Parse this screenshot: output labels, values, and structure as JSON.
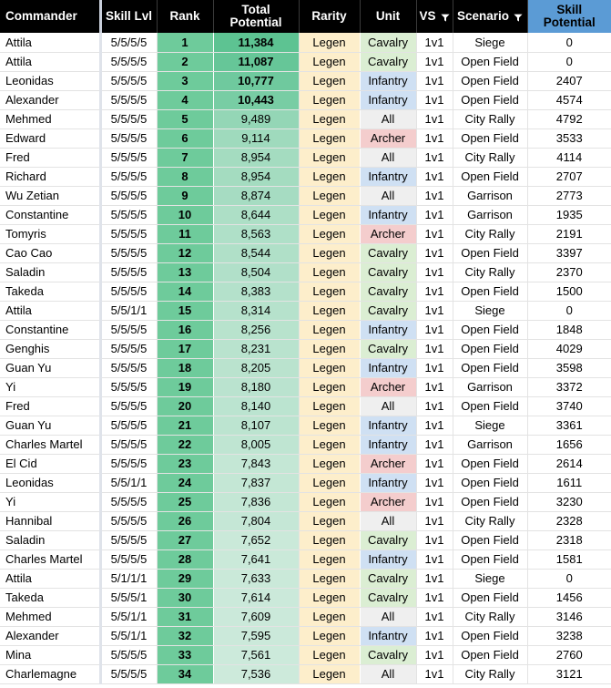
{
  "table": {
    "columns": [
      {
        "key": "commander",
        "label": "Commander",
        "filter": false
      },
      {
        "key": "skill_lvl",
        "label": "Skill Lvl",
        "filter": false
      },
      {
        "key": "rank",
        "label": "Rank",
        "filter": false
      },
      {
        "key": "total_potential",
        "label": "Total Potential",
        "filter": false
      },
      {
        "key": "rarity",
        "label": "Rarity",
        "filter": false
      },
      {
        "key": "unit",
        "label": "Unit",
        "filter": false
      },
      {
        "key": "vs",
        "label": "VS",
        "filter": true,
        "filter_icon": "filter-icon"
      },
      {
        "key": "scenario",
        "label": "Scenario",
        "filter": true,
        "filter_icon": "filter-icon"
      },
      {
        "key": "skill_potential",
        "label": "Skill Potential",
        "filter": false
      }
    ],
    "header_colors": {
      "background": "#000000",
      "text": "#ffffff",
      "skill_potential_background": "#5b9bd5",
      "skill_potential_text": "#000000"
    },
    "cell_colors": {
      "rank": "#6ecb9b",
      "total_high": "#5dc392",
      "total_low": "#cdeadb",
      "rarity_legendary": "#fdeecb",
      "unit_cavalry": "#dbeed3",
      "unit_infantry": "#cfe0f3",
      "unit_archer": "#f4cdcd",
      "unit_all": "#efefef",
      "row_background": "#ffffff"
    },
    "rows": [
      {
        "commander": "Attila",
        "skill_lvl": "5/5/5/5",
        "rank": "1",
        "total_potential": "11,384",
        "rarity": "Legen",
        "unit": "Cavalry",
        "vs": "1v1",
        "scenario": "Siege",
        "skill_potential": "0"
      },
      {
        "commander": "Attila",
        "skill_lvl": "5/5/5/5",
        "rank": "2",
        "total_potential": "11,087",
        "rarity": "Legen",
        "unit": "Cavalry",
        "vs": "1v1",
        "scenario": "Open Field",
        "skill_potential": "0"
      },
      {
        "commander": "Leonidas",
        "skill_lvl": "5/5/5/5",
        "rank": "3",
        "total_potential": "10,777",
        "rarity": "Legen",
        "unit": "Infantry",
        "vs": "1v1",
        "scenario": "Open Field",
        "skill_potential": "2407"
      },
      {
        "commander": "Alexander",
        "skill_lvl": "5/5/5/5",
        "rank": "4",
        "total_potential": "10,443",
        "rarity": "Legen",
        "unit": "Infantry",
        "vs": "1v1",
        "scenario": "Open Field",
        "skill_potential": "4574"
      },
      {
        "commander": "Mehmed",
        "skill_lvl": "5/5/5/5",
        "rank": "5",
        "total_potential": "9,489",
        "rarity": "Legen",
        "unit": "All",
        "vs": "1v1",
        "scenario": "City Rally",
        "skill_potential": "4792"
      },
      {
        "commander": "Edward",
        "skill_lvl": "5/5/5/5",
        "rank": "6",
        "total_potential": "9,114",
        "rarity": "Legen",
        "unit": "Archer",
        "vs": "1v1",
        "scenario": "Open Field",
        "skill_potential": "3533"
      },
      {
        "commander": "Fred",
        "skill_lvl": "5/5/5/5",
        "rank": "7",
        "total_potential": "8,954",
        "rarity": "Legen",
        "unit": "All",
        "vs": "1v1",
        "scenario": "City Rally",
        "skill_potential": "4114"
      },
      {
        "commander": "Richard",
        "skill_lvl": "5/5/5/5",
        "rank": "8",
        "total_potential": "8,954",
        "rarity": "Legen",
        "unit": "Infantry",
        "vs": "1v1",
        "scenario": "Open Field",
        "skill_potential": "2707"
      },
      {
        "commander": "Wu Zetian",
        "skill_lvl": "5/5/5/5",
        "rank": "9",
        "total_potential": "8,874",
        "rarity": "Legen",
        "unit": "All",
        "vs": "1v1",
        "scenario": "Garrison",
        "skill_potential": "2773"
      },
      {
        "commander": "Constantine",
        "skill_lvl": "5/5/5/5",
        "rank": "10",
        "total_potential": "8,644",
        "rarity": "Legen",
        "unit": "Infantry",
        "vs": "1v1",
        "scenario": "Garrison",
        "skill_potential": "1935"
      },
      {
        "commander": "Tomyris",
        "skill_lvl": "5/5/5/5",
        "rank": "11",
        "total_potential": "8,563",
        "rarity": "Legen",
        "unit": "Archer",
        "vs": "1v1",
        "scenario": "City Rally",
        "skill_potential": "2191"
      },
      {
        "commander": "Cao Cao",
        "skill_lvl": "5/5/5/5",
        "rank": "12",
        "total_potential": "8,544",
        "rarity": "Legen",
        "unit": "Cavalry",
        "vs": "1v1",
        "scenario": "Open Field",
        "skill_potential": "3397"
      },
      {
        "commander": "Saladin",
        "skill_lvl": "5/5/5/5",
        "rank": "13",
        "total_potential": "8,504",
        "rarity": "Legen",
        "unit": "Cavalry",
        "vs": "1v1",
        "scenario": "City Rally",
        "skill_potential": "2370"
      },
      {
        "commander": "Takeda",
        "skill_lvl": "5/5/5/5",
        "rank": "14",
        "total_potential": "8,383",
        "rarity": "Legen",
        "unit": "Cavalry",
        "vs": "1v1",
        "scenario": "Open Field",
        "skill_potential": "1500"
      },
      {
        "commander": "Attila",
        "skill_lvl": "5/5/1/1",
        "rank": "15",
        "total_potential": "8,314",
        "rarity": "Legen",
        "unit": "Cavalry",
        "vs": "1v1",
        "scenario": "Siege",
        "skill_potential": "0"
      },
      {
        "commander": "Constantine",
        "skill_lvl": "5/5/5/5",
        "rank": "16",
        "total_potential": "8,256",
        "rarity": "Legen",
        "unit": "Infantry",
        "vs": "1v1",
        "scenario": "Open Field",
        "skill_potential": "1848"
      },
      {
        "commander": "Genghis",
        "skill_lvl": "5/5/5/5",
        "rank": "17",
        "total_potential": "8,231",
        "rarity": "Legen",
        "unit": "Cavalry",
        "vs": "1v1",
        "scenario": "Open Field",
        "skill_potential": "4029"
      },
      {
        "commander": "Guan Yu",
        "skill_lvl": "5/5/5/5",
        "rank": "18",
        "total_potential": "8,205",
        "rarity": "Legen",
        "unit": "Infantry",
        "vs": "1v1",
        "scenario": "Open Field",
        "skill_potential": "3598"
      },
      {
        "commander": "Yi",
        "skill_lvl": "5/5/5/5",
        "rank": "19",
        "total_potential": "8,180",
        "rarity": "Legen",
        "unit": "Archer",
        "vs": "1v1",
        "scenario": "Garrison",
        "skill_potential": "3372"
      },
      {
        "commander": "Fred",
        "skill_lvl": "5/5/5/5",
        "rank": "20",
        "total_potential": "8,140",
        "rarity": "Legen",
        "unit": "All",
        "vs": "1v1",
        "scenario": "Open Field",
        "skill_potential": "3740"
      },
      {
        "commander": "Guan Yu",
        "skill_lvl": "5/5/5/5",
        "rank": "21",
        "total_potential": "8,107",
        "rarity": "Legen",
        "unit": "Infantry",
        "vs": "1v1",
        "scenario": "Siege",
        "skill_potential": "3361"
      },
      {
        "commander": "Charles Martel",
        "skill_lvl": "5/5/5/5",
        "rank": "22",
        "total_potential": "8,005",
        "rarity": "Legen",
        "unit": "Infantry",
        "vs": "1v1",
        "scenario": "Garrison",
        "skill_potential": "1656"
      },
      {
        "commander": "El Cid",
        "skill_lvl": "5/5/5/5",
        "rank": "23",
        "total_potential": "7,843",
        "rarity": "Legen",
        "unit": "Archer",
        "vs": "1v1",
        "scenario": "Open Field",
        "skill_potential": "2614"
      },
      {
        "commander": "Leonidas",
        "skill_lvl": "5/5/1/1",
        "rank": "24",
        "total_potential": "7,837",
        "rarity": "Legen",
        "unit": "Infantry",
        "vs": "1v1",
        "scenario": "Open Field",
        "skill_potential": "1611"
      },
      {
        "commander": "Yi",
        "skill_lvl": "5/5/5/5",
        "rank": "25",
        "total_potential": "7,836",
        "rarity": "Legen",
        "unit": "Archer",
        "vs": "1v1",
        "scenario": "Open Field",
        "skill_potential": "3230"
      },
      {
        "commander": "Hannibal",
        "skill_lvl": "5/5/5/5",
        "rank": "26",
        "total_potential": "7,804",
        "rarity": "Legen",
        "unit": "All",
        "vs": "1v1",
        "scenario": "City Rally",
        "skill_potential": "2328"
      },
      {
        "commander": "Saladin",
        "skill_lvl": "5/5/5/5",
        "rank": "27",
        "total_potential": "7,652",
        "rarity": "Legen",
        "unit": "Cavalry",
        "vs": "1v1",
        "scenario": "Open Field",
        "skill_potential": "2318"
      },
      {
        "commander": "Charles Martel",
        "skill_lvl": "5/5/5/5",
        "rank": "28",
        "total_potential": "7,641",
        "rarity": "Legen",
        "unit": "Infantry",
        "vs": "1v1",
        "scenario": "Open Field",
        "skill_potential": "1581"
      },
      {
        "commander": "Attila",
        "skill_lvl": "5/1/1/1",
        "rank": "29",
        "total_potential": "7,633",
        "rarity": "Legen",
        "unit": "Cavalry",
        "vs": "1v1",
        "scenario": "Siege",
        "skill_potential": "0"
      },
      {
        "commander": "Takeda",
        "skill_lvl": "5/5/5/1",
        "rank": "30",
        "total_potential": "7,614",
        "rarity": "Legen",
        "unit": "Cavalry",
        "vs": "1v1",
        "scenario": "Open Field",
        "skill_potential": "1456"
      },
      {
        "commander": "Mehmed",
        "skill_lvl": "5/5/1/1",
        "rank": "31",
        "total_potential": "7,609",
        "rarity": "Legen",
        "unit": "All",
        "vs": "1v1",
        "scenario": "City Rally",
        "skill_potential": "3146"
      },
      {
        "commander": "Alexander",
        "skill_lvl": "5/5/1/1",
        "rank": "32",
        "total_potential": "7,595",
        "rarity": "Legen",
        "unit": "Infantry",
        "vs": "1v1",
        "scenario": "Open Field",
        "skill_potential": "3238"
      },
      {
        "commander": "Mina",
        "skill_lvl": "5/5/5/5",
        "rank": "33",
        "total_potential": "7,561",
        "rarity": "Legen",
        "unit": "Cavalry",
        "vs": "1v1",
        "scenario": "Open Field",
        "skill_potential": "2760"
      },
      {
        "commander": "Charlemagne",
        "skill_lvl": "5/5/5/5",
        "rank": "34",
        "total_potential": "7,536",
        "rarity": "Legen",
        "unit": "All",
        "vs": "1v1",
        "scenario": "City Rally",
        "skill_potential": "3121"
      }
    ]
  }
}
